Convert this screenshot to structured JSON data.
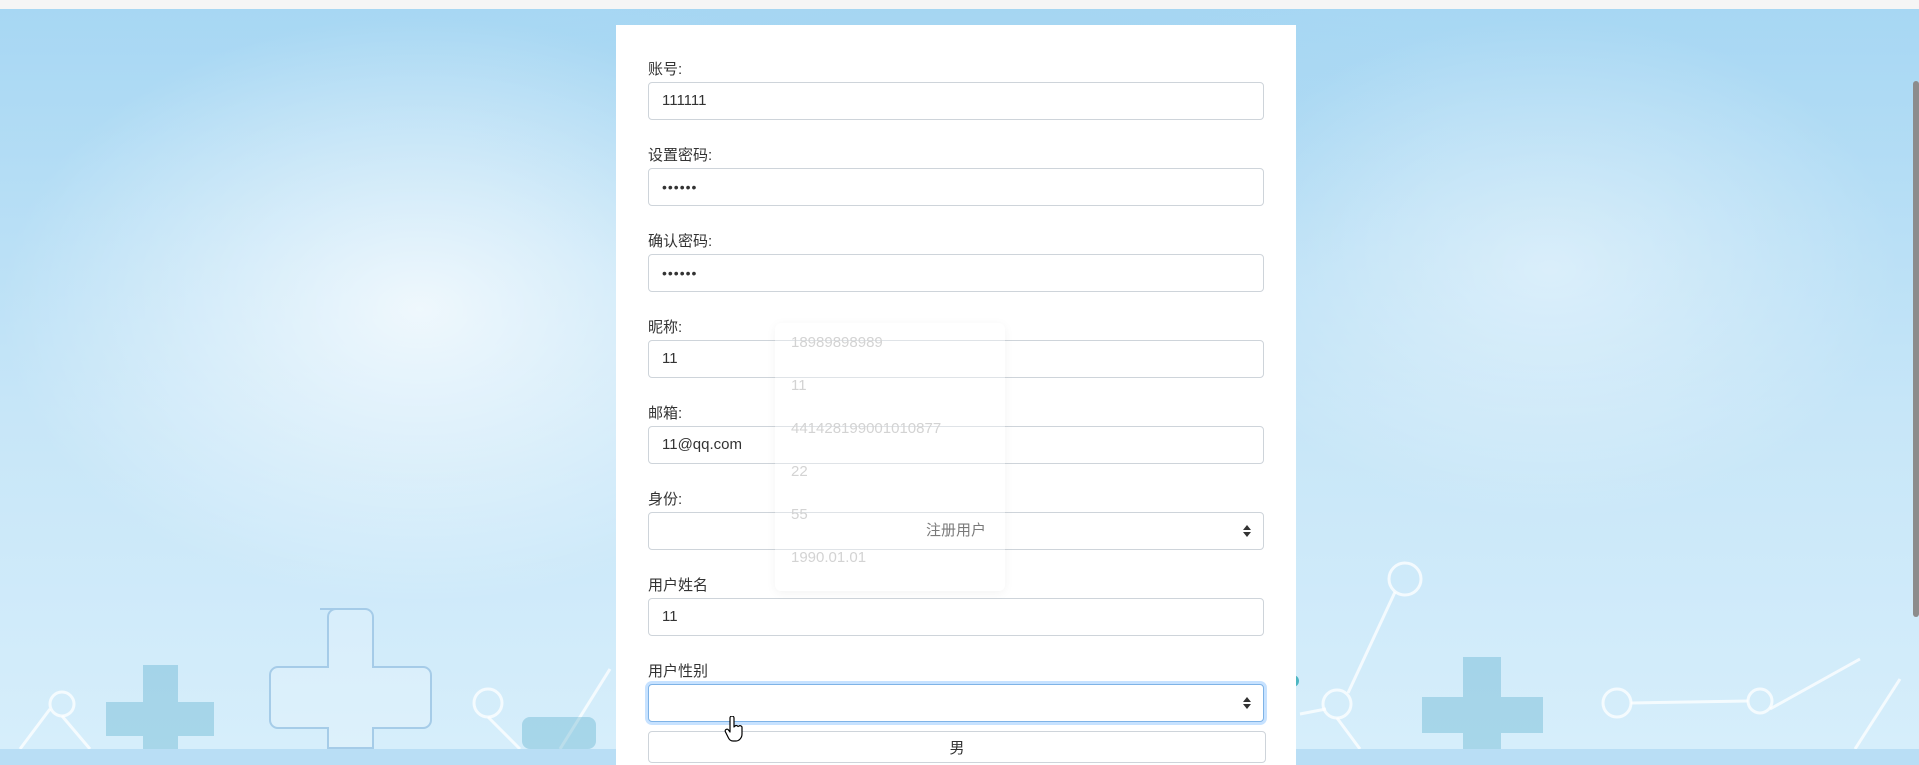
{
  "form": {
    "account": {
      "label": "账号:",
      "value": "111111"
    },
    "password": {
      "label": "设置密码:",
      "value": "••••••"
    },
    "confirm_password": {
      "label": "确认密码:",
      "value": "••••••"
    },
    "nickname": {
      "label": "昵称:",
      "value": "11"
    },
    "email": {
      "label": "邮箱:",
      "value": "11@qq.com"
    },
    "identity": {
      "label": "身份:",
      "selected": "注册用户"
    },
    "real_name": {
      "label": "用户姓名",
      "value": "11"
    },
    "gender": {
      "label": "用户性别",
      "selected": ""
    }
  },
  "autocomplete": {
    "items": [
      "18989898989",
      "11",
      "441428199001010877",
      "22",
      "55",
      "1990.01.01"
    ]
  },
  "gender_dropdown": {
    "first_option": "男"
  },
  "colors": {
    "accent_focus": "#7fb3e6",
    "background": "#b9def5",
    "card": "#ffffff"
  }
}
